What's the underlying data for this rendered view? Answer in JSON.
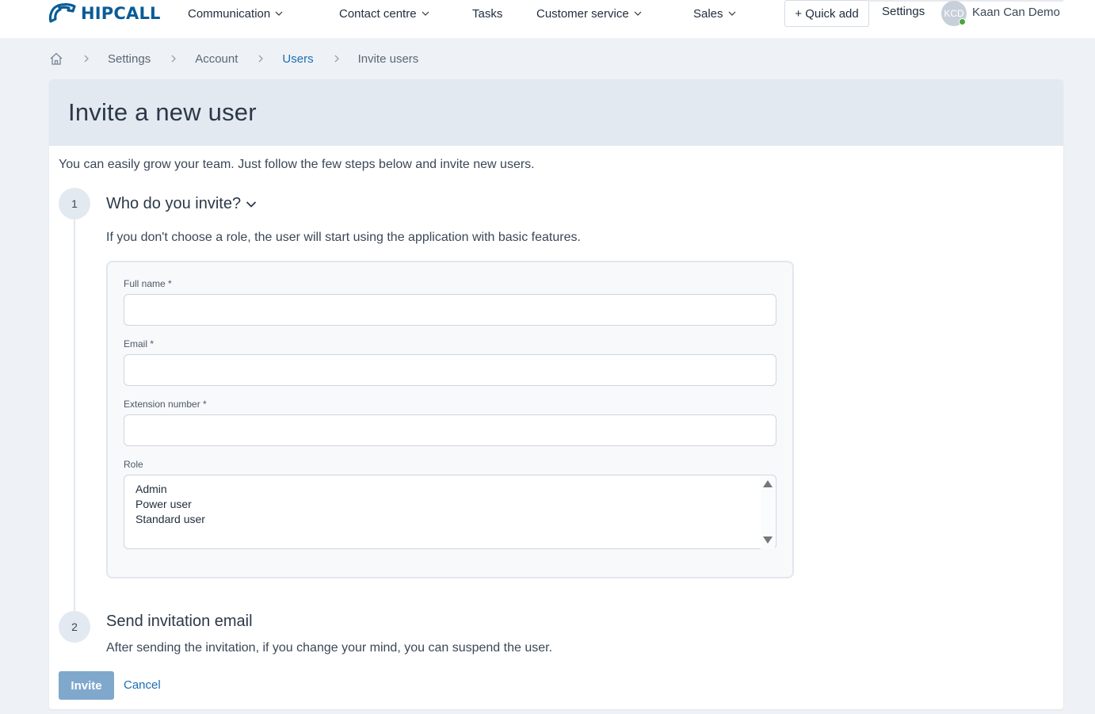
{
  "brand": {
    "name": "HIPCALL",
    "color": "#0a5c96"
  },
  "nav": {
    "items": [
      {
        "label": "Communication",
        "dropdown": true
      },
      {
        "label": "Contact centre",
        "dropdown": true
      },
      {
        "label": "Tasks",
        "dropdown": false
      },
      {
        "label": "Customer service",
        "dropdown": true
      },
      {
        "label": "Sales",
        "dropdown": true
      }
    ],
    "quick_add": "+ Quick add",
    "settings": "Settings",
    "user": {
      "initials": "KCD",
      "name": "Kaan Can Demo",
      "status_color": "#4aa63a"
    }
  },
  "breadcrumb": [
    "Settings",
    "Account",
    "Users",
    "Invite users"
  ],
  "page": {
    "title": "Invite a new user",
    "intro": "You can easily grow your team. Just follow the few steps below and invite new users."
  },
  "steps": [
    {
      "number": "1",
      "title": "Who do you invite?",
      "description": "If you don't choose a role, the user will start using the application with basic features."
    },
    {
      "number": "2",
      "title": "Send invitation email",
      "description": "After sending the invitation, if you change your mind, you can suspend the user."
    }
  ],
  "form": {
    "full_name": {
      "label": "Full name *",
      "value": ""
    },
    "email": {
      "label": "Email *",
      "value": ""
    },
    "extension": {
      "label": "Extension number *",
      "value": ""
    },
    "role": {
      "label": "Role",
      "options": [
        "Admin",
        "Power user",
        "Standard user"
      ]
    }
  },
  "actions": {
    "invite": "Invite",
    "cancel": "Cancel"
  },
  "colors": {
    "accent": "#1b6fb3",
    "invite_button": "#7fa8cc",
    "header_bg": "#e3e9f0"
  }
}
